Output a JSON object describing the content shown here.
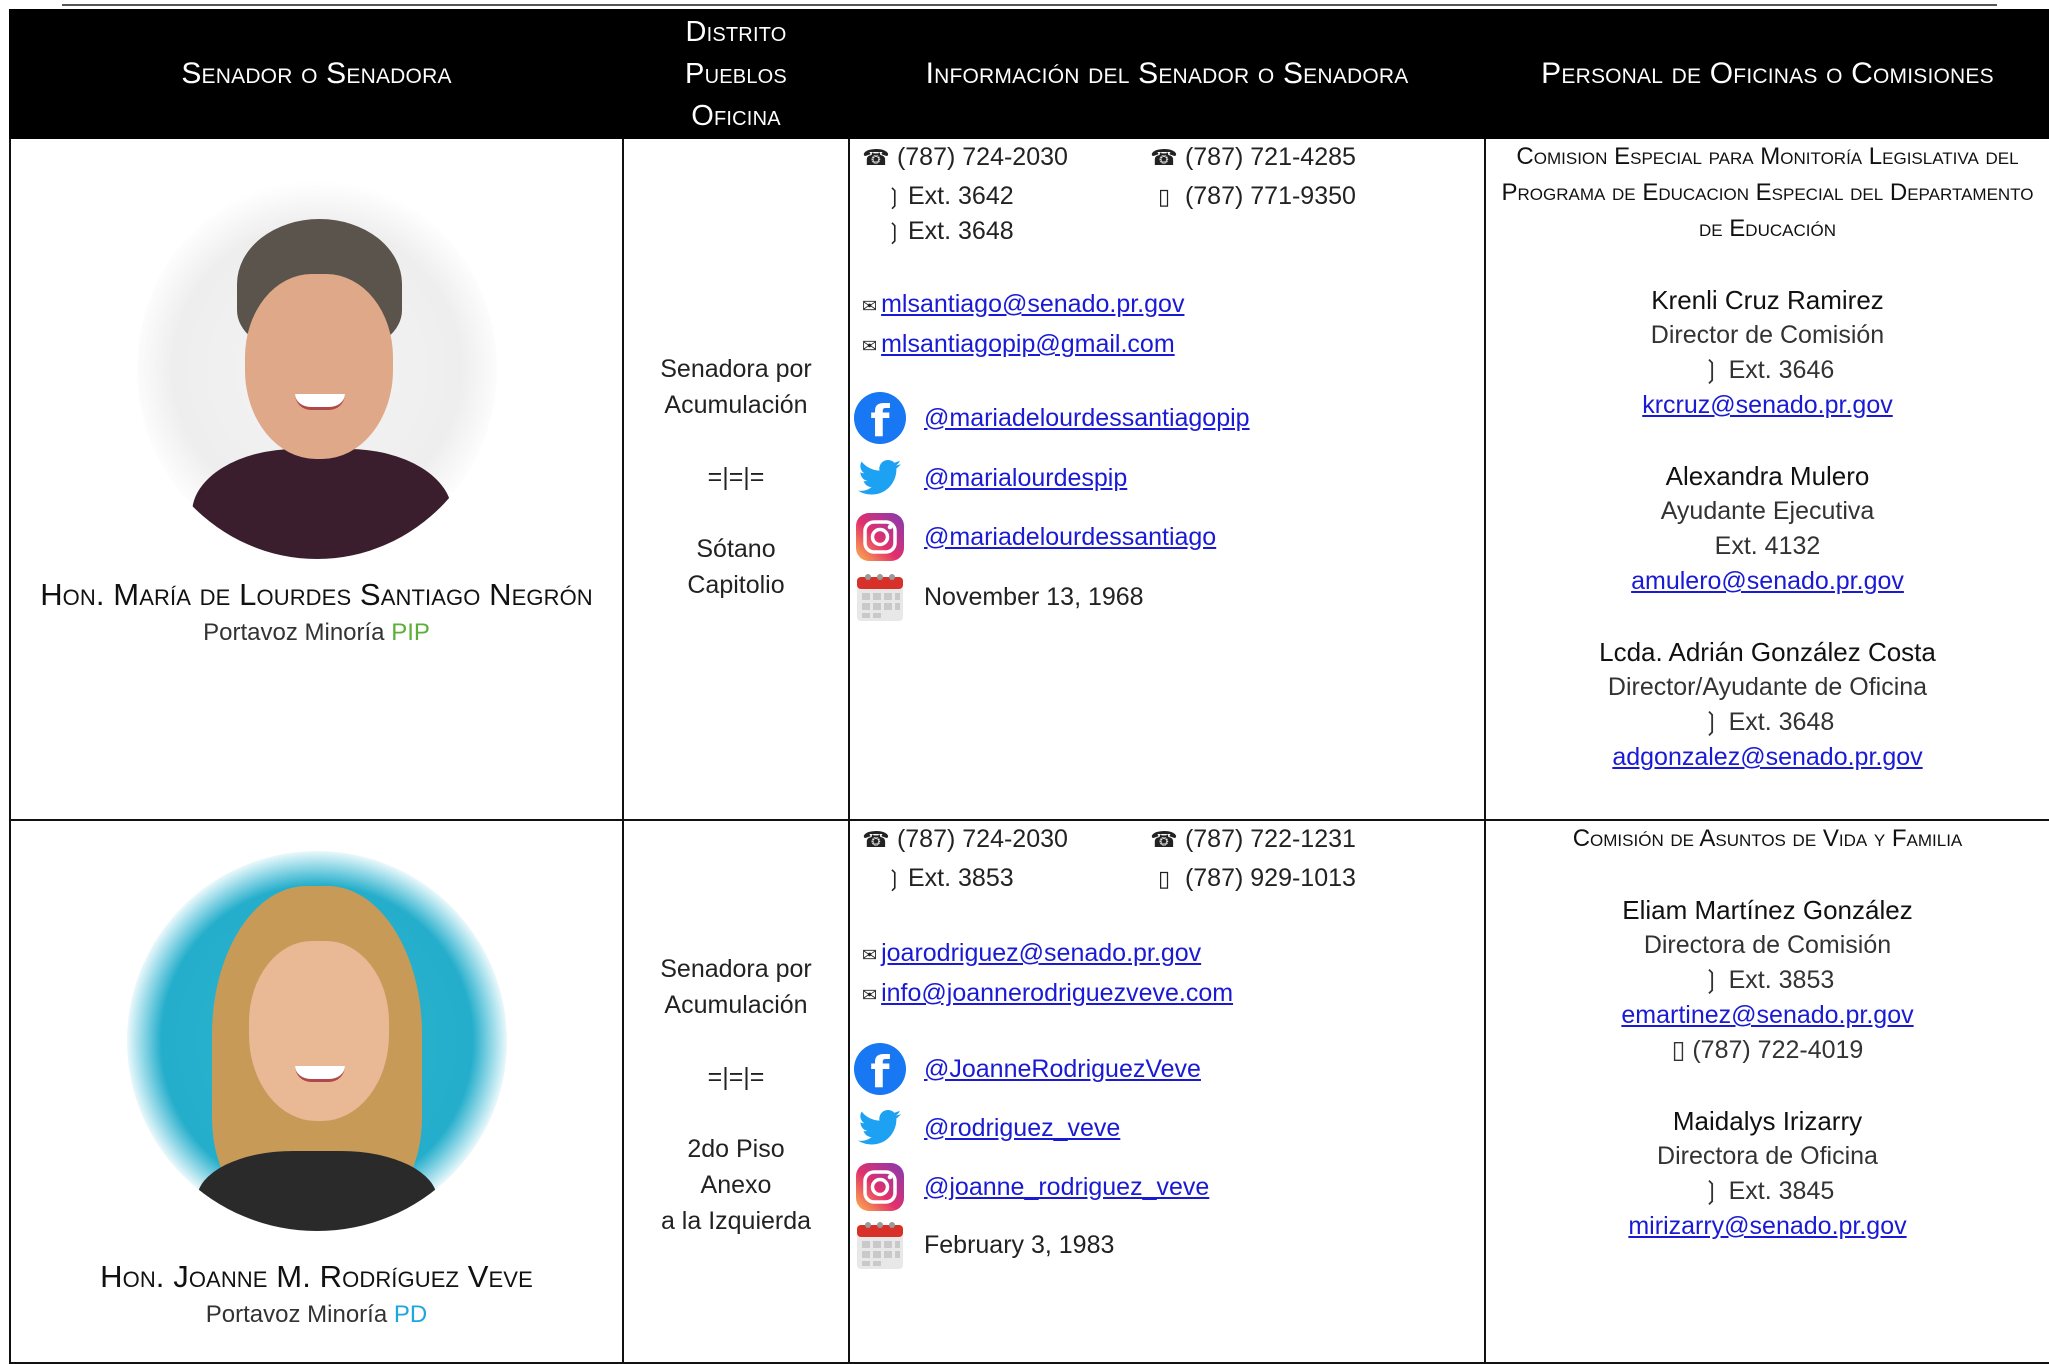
{
  "header": {
    "col1": "Senador o Senadora",
    "col2_line1": "Distrito",
    "col2_line2": "Pueblos",
    "col2_line3": "Oficina",
    "col3": "Información del Senador o Senadora",
    "col4": "Personal de Oficinas o Comisiones"
  },
  "senators": [
    {
      "name": "Hon. María de Lourdes Santiago Negrón",
      "role": "Portavoz Minoría",
      "party": "PIP",
      "party_color": "#5cae3a",
      "district_line1": "Senadora por",
      "district_line2": "Acumulación",
      "separator": "=|=|=",
      "office_line1": "Sótano",
      "office_line2": "Capitolio",
      "office_line3": "",
      "phone_main": "(787) 724-2030",
      "ext_a": "Ext. 3642",
      "ext_b": "Ext. 3648",
      "phone_alt": "(787) 721-4285",
      "mobile": "(787) 771-9350",
      "email_1": "mlsantiago@senado.pr.gov",
      "email_2": "mlsantiagopip@gmail.com",
      "facebook": "@mariadelourdessantiagopip",
      "twitter": "@marialourdespip",
      "instagram": "@mariadelourdessantiago",
      "birthday": "November 13, 1968",
      "commission": "Comision Especial para Monitoría Legislativa del Programa de Educacion Especial del Departamento de Educación",
      "staff": [
        {
          "name": "Krenli Cruz Ramirez",
          "title": "Director de Comisión",
          "ext": "Ext. 3646",
          "email": "krcruz@senado.pr.gov"
        },
        {
          "name": "Alexandra Mulero",
          "title": "Ayudante Ejecutiva",
          "ext": "Ext. 4132",
          "email": "amulero@senado.pr.gov"
        },
        {
          "name": "Lcda. Adrián González Costa",
          "title": "Director/Ayudante de Oficina",
          "ext": "Ext. 3648",
          "email": "adgonzalez@senado.pr.gov"
        }
      ]
    },
    {
      "name": "Hon. Joanne M. Rodríguez Veve",
      "role": "Portavoz Minoría",
      "party": "PD",
      "party_color": "#1fa6dd",
      "district_line1": "Senadora por",
      "district_line2": "Acumulación",
      "separator": "=|=|=",
      "office_line1": "2do Piso",
      "office_line2": "Anexo",
      "office_line3": "a la Izquierda",
      "phone_main": "(787) 724-2030",
      "ext_a": "Ext. 3853",
      "phone_alt": "(787) 722-1231",
      "mobile": "(787) 929-1013",
      "email_1": "joarodriguez@senado.pr.gov",
      "email_2": "info@joannerodriguezveve.com",
      "facebook": "@JoanneRodriguezVeve",
      "twitter": "@rodriguez_veve",
      "instagram": "@joanne_rodriguez_veve",
      "birthday": "February 3, 1983",
      "commission": "Comisión de Asuntos de Vida y Familia",
      "staff": [
        {
          "name": "Eliam Martínez González",
          "title": "Directora de Comisión",
          "ext": "Ext. 3853",
          "email": "emartinez@senado.pr.gov",
          "mobile": "(787) 722-4019"
        },
        {
          "name": "Maidalys Irizarry",
          "title": "Directora de Oficina",
          "ext": "Ext. 3845",
          "email": "mirizarry@senado.pr.gov"
        }
      ]
    }
  ],
  "icons": {
    "phone": "telephone-icon",
    "extension": "extension-icon",
    "mobile": "mobile-phone-icon",
    "email": "envelope-icon",
    "facebook": "facebook-icon",
    "twitter": "twitter-icon",
    "instagram": "instagram-icon",
    "calendar": "calendar-icon"
  }
}
